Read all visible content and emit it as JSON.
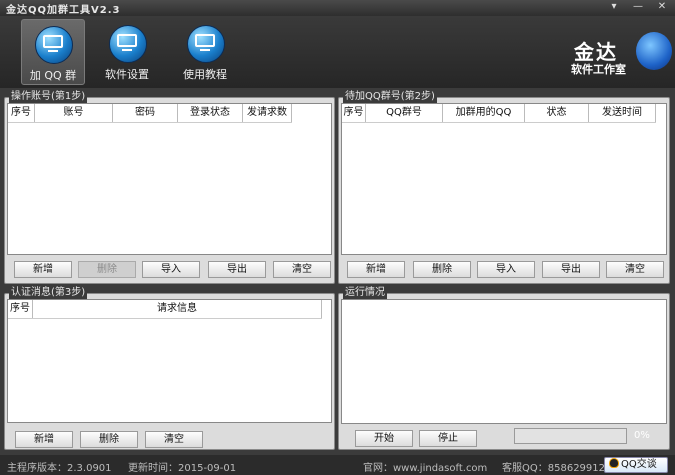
{
  "window": {
    "title": "金达QQ加群工具V2.3",
    "controls": {
      "menu": "▾",
      "minimize": "—",
      "close": "✕"
    }
  },
  "nav": [
    {
      "label": "加 QQ 群",
      "icon": "monitor-icon",
      "active": true
    },
    {
      "label": "软件设置",
      "icon": "monitor-icon",
      "active": false
    },
    {
      "label": "使用教程",
      "icon": "monitor-icon",
      "active": false
    }
  ],
  "logo": {
    "text": "金达",
    "sub": "软件工作室"
  },
  "accounts_panel": {
    "title": "操作账号(第1步)",
    "columns": [
      "序号",
      "账号",
      "密码",
      "登录状态",
      "发请求数"
    ],
    "rows": [],
    "buttons": {
      "add": "新增",
      "delete": "删除",
      "import": "导入",
      "export": "导出",
      "clear": "清空"
    }
  },
  "groups_panel": {
    "title": "待加QQ群号(第2步)",
    "columns": [
      "序号",
      "QQ群号",
      "加群用的QQ",
      "状态",
      "发送时间"
    ],
    "rows": [],
    "buttons": {
      "add": "新增",
      "delete": "删除",
      "import": "导入",
      "export": "导出",
      "clear": "清空"
    }
  },
  "verify_panel": {
    "title": "认证消息(第3步)",
    "columns": [
      "序号",
      "请求信息"
    ],
    "rows": [],
    "buttons": {
      "add": "新增",
      "delete": "删除",
      "clear": "清空"
    }
  },
  "run_panel": {
    "title": "运行情况",
    "buttons": {
      "start": "开始",
      "stop": "停止"
    },
    "progress": 0,
    "progress_label": "0%"
  },
  "status": {
    "version": "主程序版本：2.3.0901",
    "updated": "更新时间：2015-09-01",
    "website": "官网：www.jindasoft.com",
    "support_qq": "客服QQ：858629912",
    "qq_button": "QQ交谈"
  },
  "colors": {
    "accent": "#1a7fcc",
    "progress": "#3a8ee6",
    "background": "#3b3b3b"
  }
}
